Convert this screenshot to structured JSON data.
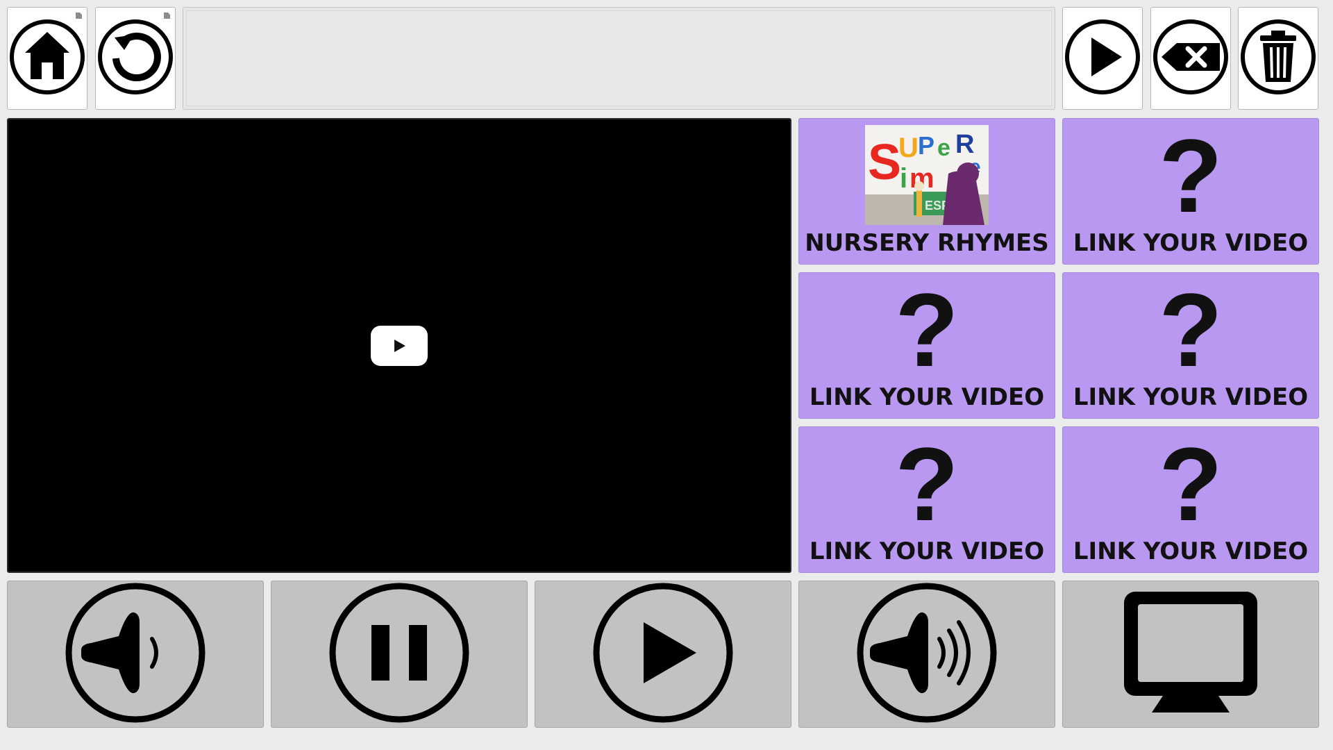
{
  "toolbar": {
    "home_icon": "home-icon",
    "undo_icon": "undo-icon",
    "speak_icon": "play-icon",
    "backspace_icon": "backspace-icon",
    "clear_icon": "trash-icon",
    "message_text": ""
  },
  "video_tiles": [
    {
      "label": "NURSERY RHYMES",
      "thumbnail_text": "SUPER SIMPLE",
      "thumbnail_sub": "ESPA"
    },
    {
      "label": "LINK YOUR VIDEO",
      "symbol": "?"
    },
    {
      "label": "LINK YOUR VIDEO",
      "symbol": "?"
    },
    {
      "label": "LINK YOUR VIDEO",
      "symbol": "?"
    },
    {
      "label": "LINK YOUR VIDEO",
      "symbol": "?"
    },
    {
      "label": "LINK YOUR VIDEO",
      "symbol": "?"
    }
  ],
  "controls": [
    {
      "icon": "volume-down-icon"
    },
    {
      "icon": "pause-icon"
    },
    {
      "icon": "play-icon"
    },
    {
      "icon": "volume-up-icon"
    },
    {
      "icon": "fullscreen-monitor-icon"
    }
  ],
  "colors": {
    "tile_purple": "#b898f0",
    "control_gray": "#c2c2c2",
    "video_bg": "#000000",
    "background": "#ebebeb"
  }
}
